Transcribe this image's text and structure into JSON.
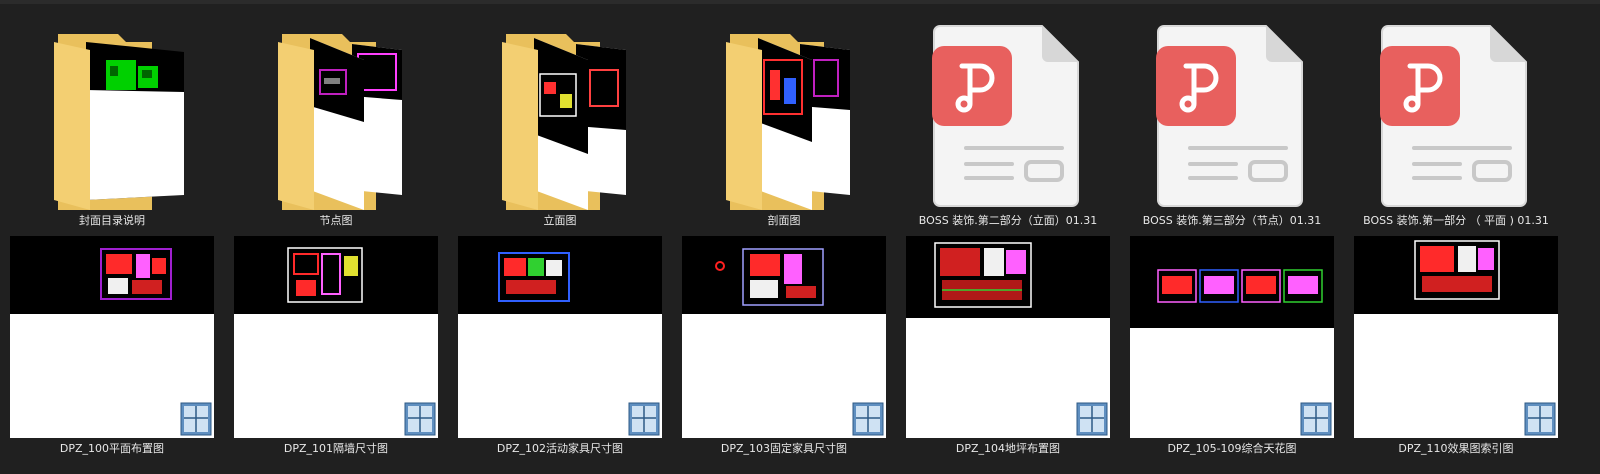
{
  "row1": [
    {
      "name": "封面目录说明",
      "kind": "folder"
    },
    {
      "name": "节点图",
      "kind": "folder"
    },
    {
      "name": "立面图",
      "kind": "folder"
    },
    {
      "name": "剖面图",
      "kind": "folder"
    },
    {
      "name": "BOSS 装饰.第二部分（立面）01.31",
      "kind": "pdf"
    },
    {
      "name": "BOSS 装饰.第三部分（节点）01.31",
      "kind": "pdf"
    },
    {
      "name": "BOSS 装饰.第一部分 （ 平面 ) 01.31",
      "kind": "pdf"
    }
  ],
  "row2": [
    {
      "name": "DPZ_100平面布置图",
      "kind": "dwg"
    },
    {
      "name": "DPZ_101隔墙尺寸图",
      "kind": "dwg"
    },
    {
      "name": "DPZ_102活动家具尺寸图",
      "kind": "dwg"
    },
    {
      "name": "DPZ_103固定家具尺寸图",
      "kind": "dwg"
    },
    {
      "name": "DPZ_104地坪布置图",
      "kind": "dwg"
    },
    {
      "name": "DPZ_105-109综合天花图",
      "kind": "dwg"
    },
    {
      "name": "DPZ_110效果图索引图",
      "kind": "dwg"
    }
  ],
  "icons": {
    "folder": "folder-icon",
    "pdf": "pdf-document-icon",
    "dwg": "dwg-file-icon"
  },
  "colors": {
    "background": "#202020",
    "folder": "#f3cf72",
    "pdf_accent": "#e8605e",
    "label": "#e8e8e8"
  }
}
